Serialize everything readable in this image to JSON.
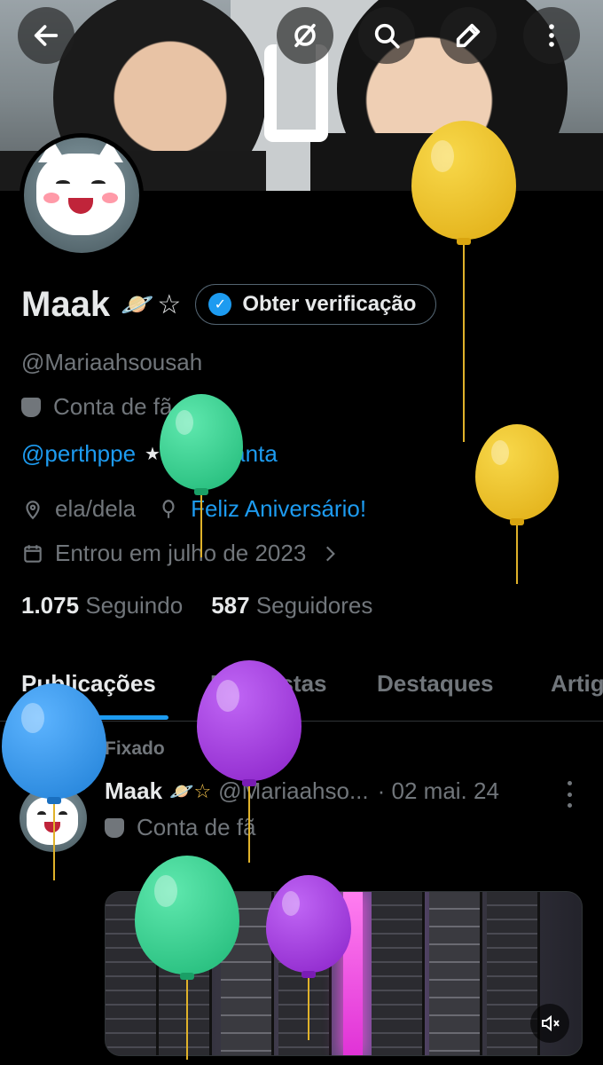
{
  "header": {
    "back_icon": "arrow-left-icon",
    "action_icons": [
      "no-signal-icon",
      "search-icon",
      "edit-icon",
      "more-vertical-icon"
    ]
  },
  "profile": {
    "name": "Maak",
    "name_emoji": "🪐",
    "name_star": "☆",
    "verify_label": "Obter verificação",
    "handle": "@Mariaahsousah",
    "bio": "Conta de fã",
    "mention1": "@perthppe",
    "mention_sep": "★",
    "mention2": "@Ppsanta",
    "pronouns": "ela/dela",
    "birthday": "Feliz Aniversário!",
    "joined": "Entrou em julho de 2023",
    "following_count": "1.075",
    "following_label": "Seguindo",
    "followers_count": "587",
    "followers_label": "Seguidores"
  },
  "tabs": [
    "Publicações",
    "Respostas",
    "Destaques",
    "Artig"
  ],
  "post": {
    "pinned_label": "Fixado",
    "name": "Maak",
    "name_emoji": "🪐☆",
    "handle": "@Mariaahso...",
    "date": "· 02 mai. 24",
    "bio": "Conta de fã"
  },
  "colors": {
    "accent": "#1d9bf0",
    "muted": "#71767b",
    "balloon_yellow": "#e8b81f",
    "balloon_green": "#2ecf8c",
    "balloon_purple": "#9a2fd6",
    "balloon_blue": "#2b8fe6"
  }
}
